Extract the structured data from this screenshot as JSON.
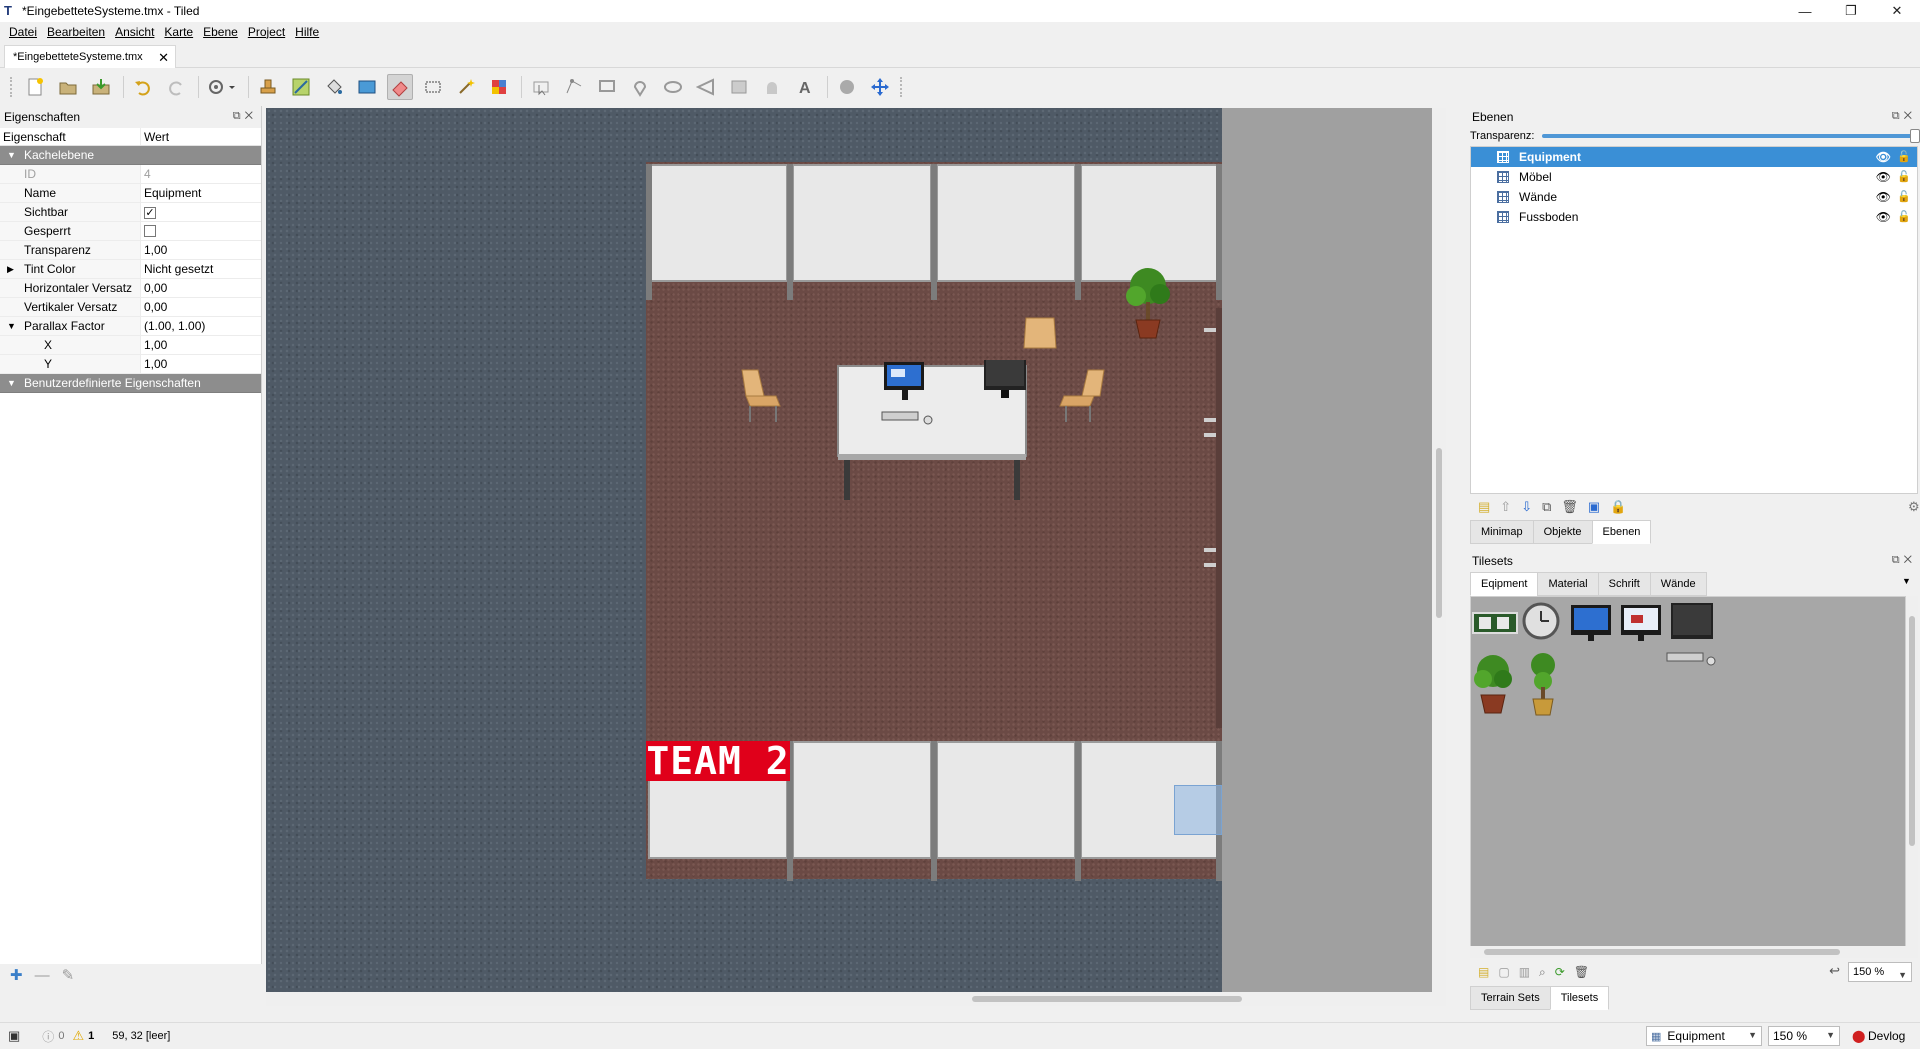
{
  "window": {
    "title": "*EingebetteteSysteme.tmx - Tiled",
    "controls": [
      "—",
      "❐",
      "✕"
    ]
  },
  "menu": [
    "Datei",
    "Bearbeiten",
    "Ansicht",
    "Karte",
    "Ebene",
    "Project",
    "Hilfe"
  ],
  "document_tab": {
    "label": "*EingebetteteSysteme.tmx",
    "close": "✕"
  },
  "properties": {
    "panel_title": "Eigenschaften",
    "col_property": "Eigenschaft",
    "col_value": "Wert",
    "group_layer": "Kachelebene",
    "rows": [
      {
        "key": "ID",
        "value": "4",
        "dim": true
      },
      {
        "key": "Name",
        "value": "Equipment"
      },
      {
        "key": "Sichtbar",
        "value": "✓",
        "checkbox": true
      },
      {
        "key": "Gesperrt",
        "value": "",
        "checkbox": true
      },
      {
        "key": "Transparenz",
        "value": "1,00"
      },
      {
        "key": "Tint Color",
        "value": "Nicht gesetzt",
        "collapsed": true
      },
      {
        "key": "Horizontaler Versatz",
        "value": "0,00"
      },
      {
        "key": "Vertikaler Versatz",
        "value": "0,00"
      },
      {
        "key": "Parallax Factor",
        "value": "(1.00, 1.00)",
        "expanded": true
      },
      {
        "key": "X",
        "value": "1,00",
        "sub": true
      },
      {
        "key": "Y",
        "value": "1,00",
        "sub": true
      }
    ],
    "group_custom": "Benutzerdefinierte Eigenschaften"
  },
  "map": {
    "team_sign": "TEAM 2"
  },
  "layers": {
    "panel_title": "Ebenen",
    "opacity_label": "Transparenz:",
    "opacity_value": 1.0,
    "items": [
      {
        "name": "Equipment",
        "selected": true
      },
      {
        "name": "Möbel"
      },
      {
        "name": "Wände"
      },
      {
        "name": "Fussboden"
      }
    ],
    "tabs": [
      "Minimap",
      "Objekte",
      "Ebenen"
    ],
    "active_tab": "Ebenen"
  },
  "tilesets": {
    "panel_title": "Tilesets",
    "tabs": [
      "Eqipment",
      "Material",
      "Schrift",
      "Wände"
    ],
    "active_tab": "Eqipment",
    "zoom": "150 %",
    "bottom_tabs": [
      "Terrain Sets",
      "Tilesets"
    ],
    "active_bottom_tab": "Tilesets"
  },
  "status": {
    "errors": "0",
    "warnings": "1",
    "coords": "59, 32 [leer]",
    "layer_combo": "Equipment",
    "zoom_combo": "150 %",
    "devlog": "Devlog"
  },
  "colors": {
    "accent": "#3a8fd6",
    "team_sign": "#e0001a",
    "floor": "#6b4a45",
    "carpet": "#4f5a66"
  }
}
